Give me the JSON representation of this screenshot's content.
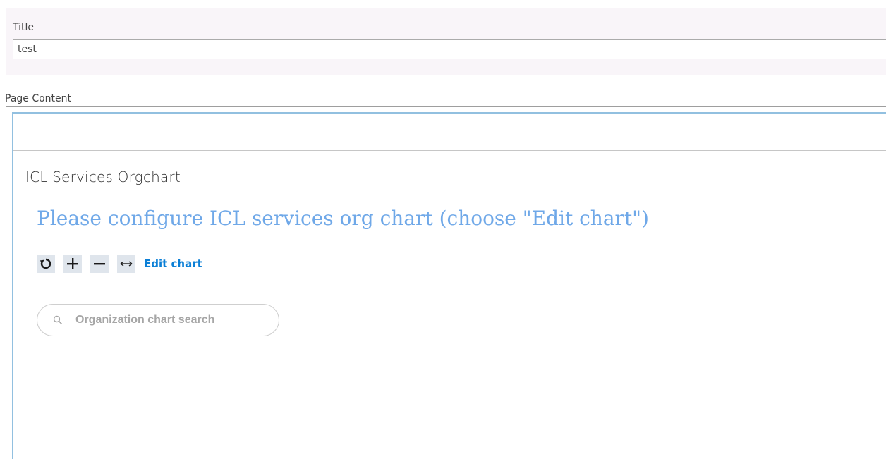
{
  "form": {
    "title_label": "Title",
    "title_value": "test",
    "content_label": "Page Content"
  },
  "webpart": {
    "title": "ICL Services Orgchart",
    "message": "Please configure ICL services org chart (choose \"Edit chart\")",
    "toolbar": {
      "buttons": [
        {
          "icon": "refresh-icon"
        },
        {
          "icon": "zoom-in-icon"
        },
        {
          "icon": "zoom-out-icon"
        },
        {
          "icon": "fit-width-icon"
        }
      ],
      "edit_label": "Edit chart"
    },
    "search": {
      "placeholder": "Organization chart search"
    }
  },
  "colors": {
    "message": "#6fa8e8",
    "link": "#0b7fd6",
    "button_bg": "#dfe5ec",
    "editor_border": "#92c0e0"
  }
}
